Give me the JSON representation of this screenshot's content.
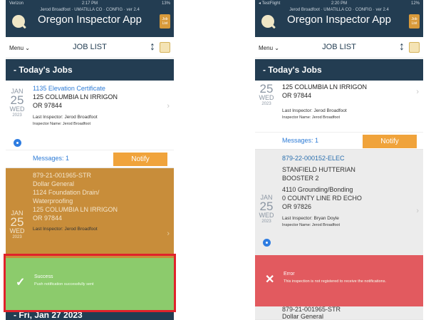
{
  "left": {
    "status": {
      "carrier": "Verizon",
      "time": "2:17 PM",
      "battery": "13%"
    },
    "header": {
      "subinfo": "Jerod Broadfoot · UMATILLA CO · CONFIG · ver 2.4",
      "title": "Oregon Inspector App",
      "joblist_label": "Job List"
    },
    "nav": {
      "menu": "Menu ⌄",
      "title": "JOB LIST"
    },
    "day_header": "- Today's Jobs",
    "job1": {
      "mon": "JAN",
      "day": "25",
      "wd": "WED",
      "yr": "2023",
      "type": "1135 Elevation Certificate",
      "addr1": "125 COLUMBIA LN IRRIGON",
      "addr2": "OR 97844",
      "last_inspector": "Last Inspector: Jerod Broadfoot",
      "inspector_name": "Inspector Name: Jerod Broadfoot",
      "messages": "Messages: 1",
      "notify": "Notify"
    },
    "job2": {
      "mon": "JAN",
      "day": "25",
      "wd": "WED",
      "yr": "2023",
      "permit": "879-21-001965-STR",
      "owner": "Dollar General",
      "type1": "1124 Foundation Drain/",
      "type2": "Waterproofing",
      "addr1": "125 COLUMBIA LN IRRIGON",
      "addr2": "OR 97844",
      "last_inspector": "Last Inspector: Jerod Broadfoot"
    },
    "toast": {
      "icon": "✓",
      "title": "Success",
      "message": "Push notification successfully sent"
    },
    "next_day": "- Fri, Jan 27 2023"
  },
  "right": {
    "status": {
      "carrier": "◂ TestFlight",
      "time": "2:20 PM",
      "battery": "12%"
    },
    "header": {
      "subinfo": "Jerod Broadfoot · UMATILLA CO · CONFIG · ver 2.4",
      "title": "Oregon Inspector App",
      "joblist_label": "Job List"
    },
    "nav": {
      "menu": "Menu ⌄",
      "title": "JOB LIST"
    },
    "day_header": "- Today's Jobs",
    "job1": {
      "day": "25",
      "wd": "WED",
      "yr": "2023",
      "addr1": "125 COLUMBIA LN IRRIGON",
      "addr2": "OR 97844",
      "last_inspector": "Last Inspector: Jerod Broadfoot",
      "inspector_name": "Inspector Name: Jerod Broadfoot",
      "messages": "Messages: 1",
      "notify": "Notify"
    },
    "job2": {
      "mon": "JAN",
      "day": "25",
      "wd": "WED",
      "yr": "2023",
      "permit": "879-22-000152-ELEC",
      "owner1": "STANFIELD HUTTERIAN",
      "owner2": "BOOSTER 2",
      "type": "4110 Grounding/Bonding",
      "addr1": "0 COUNTY LINE RD ECHO",
      "addr2": "OR 97826",
      "last_inspector": "Last Inspector: Bryan Doyle",
      "inspector_name": "Inspector Name: Jerod Broadfoot"
    },
    "toast": {
      "icon": "✕",
      "title": "Error",
      "message": "This inspection is not registered to receive the notifications."
    },
    "job3": {
      "permit": "879-21-001965-STR",
      "owner": "Dollar General"
    }
  }
}
